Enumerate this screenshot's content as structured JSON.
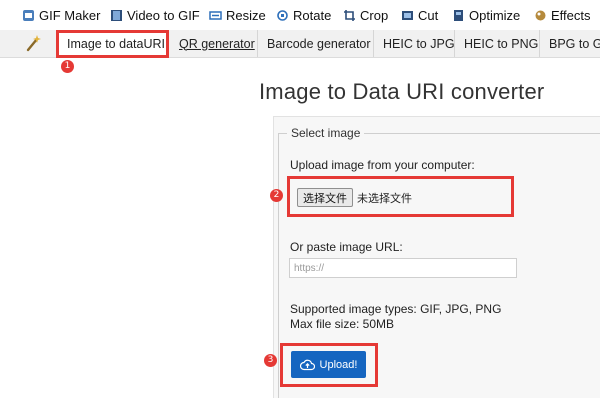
{
  "toolbar": {
    "items": [
      {
        "label": "GIF Maker",
        "icon": "gif-maker-icon"
      },
      {
        "label": "Video to GIF",
        "icon": "film-icon"
      },
      {
        "label": "Resize",
        "icon": "resize-icon"
      },
      {
        "label": "Rotate",
        "icon": "rotate-icon"
      },
      {
        "label": "Crop",
        "icon": "crop-icon"
      },
      {
        "label": "Cut",
        "icon": "cut-icon"
      },
      {
        "label": "Optimize",
        "icon": "optimize-icon"
      },
      {
        "label": "Effects",
        "icon": "effects-icon"
      }
    ]
  },
  "tabs": {
    "items": [
      {
        "label": "Image to dataURI",
        "active": true
      },
      {
        "label": "QR generator"
      },
      {
        "label": "Barcode generator"
      },
      {
        "label": "HEIC to JPG"
      },
      {
        "label": "HEIC to PNG"
      },
      {
        "label": "BPG to GI"
      }
    ]
  },
  "annotations": {
    "markers": [
      "1",
      "2",
      "3"
    ],
    "color": "#e53935"
  },
  "page": {
    "title": "Image to Data URI converter"
  },
  "form": {
    "legend": "Select image",
    "upload_label": "Upload image from your computer:",
    "file_button": "选择文件",
    "file_status": "未选择文件",
    "url_label": "Or paste image URL:",
    "url_placeholder": "https://",
    "url_value": "",
    "supported_types": "Supported image types: GIF, JPG, PNG",
    "max_size": "Max file size: 50MB",
    "upload_button": "Upload!",
    "upload_button_color": "#1565c0"
  }
}
